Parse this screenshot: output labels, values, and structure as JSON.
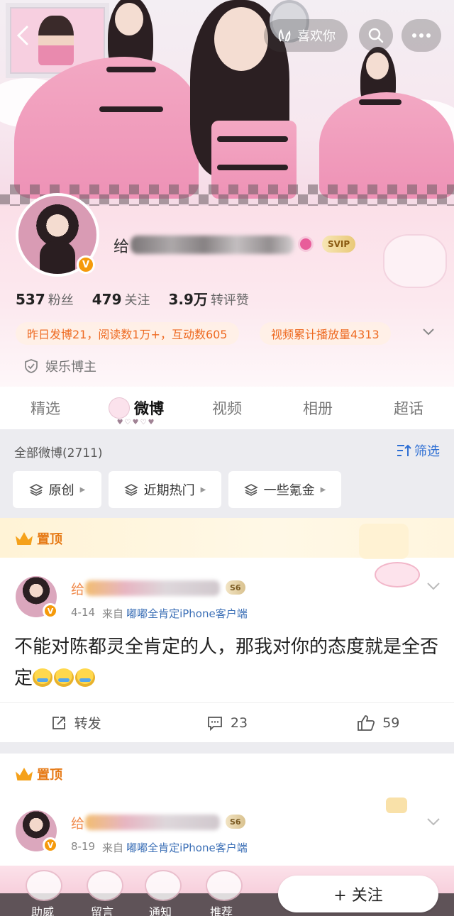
{
  "header": {
    "like_label": "喜欢你",
    "name_first_char": "给",
    "svip_label": "SVIP"
  },
  "stats": [
    {
      "value": "537",
      "label": "粉丝"
    },
    {
      "value": "479",
      "label": "关注"
    },
    {
      "value": "3.9万",
      "label": "转评赞"
    }
  ],
  "highlights": {
    "yesterday": "昨日发博21，阅读数1万+，互动数605",
    "video": "视频累计播放量4313"
  },
  "tag": "娱乐博主",
  "tabs": [
    {
      "label": "精选"
    },
    {
      "label": "微博"
    },
    {
      "label": "视频"
    },
    {
      "label": "相册"
    },
    {
      "label": "超话"
    }
  ],
  "feed": {
    "all_count": "全部微博(2711)",
    "filter_label": "筛选",
    "chips": [
      "原创",
      "近期热门",
      "一些氪金"
    ]
  },
  "posts": [
    {
      "pinned_label": "置顶",
      "name_first_char": "给",
      "level": "S6",
      "date": "4-14",
      "from_label": "来自",
      "source": "嘟嘟全肯定iPhone客户端",
      "text": "不能对陈都灵全肯定的人，那我对你的态度就是全否定",
      "repost_label": "转发",
      "comments": "23",
      "likes": "59"
    },
    {
      "pinned_label": "置顶",
      "name_first_char": "给",
      "level": "S6",
      "date": "8-19",
      "from_label": "来自",
      "source": "嘟嘟全肯定iPhone客户端"
    }
  ],
  "bottom_nav": [
    "助威",
    "留言",
    "通知",
    "推荐"
  ],
  "follow_label": "+ 关注",
  "colors": {
    "accent_orange": "#ee6a22",
    "link_blue": "#2e6fd4",
    "pin_orange": "#e67a16",
    "source_blue": "#3b6fb6"
  }
}
